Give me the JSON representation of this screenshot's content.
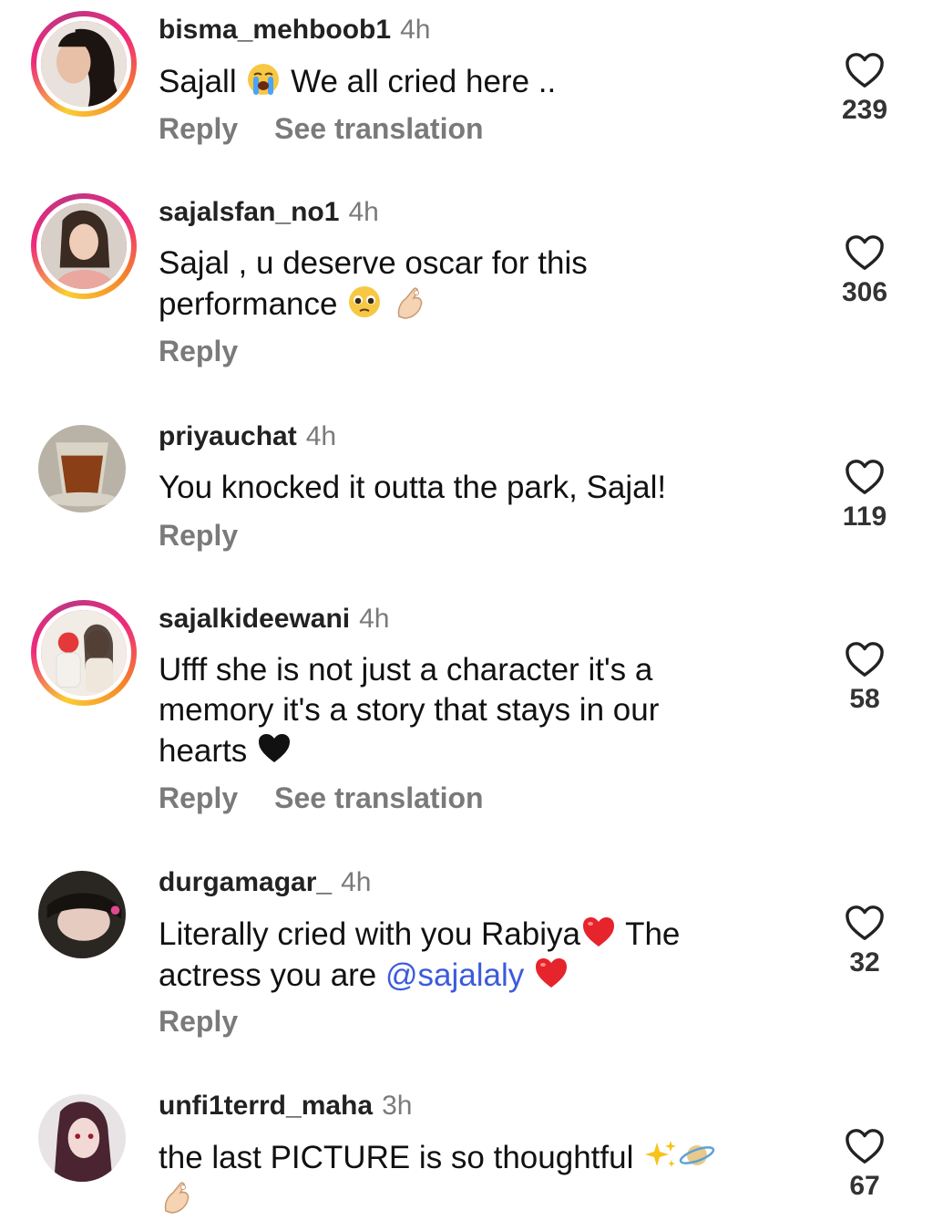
{
  "comments": [
    {
      "username": "bisma_mehboob1",
      "time": "4h",
      "text_parts": [
        "Sajall",
        "We all cried here .."
      ],
      "reply_label": "Reply",
      "translate_label": "See translation",
      "likes": "239"
    },
    {
      "username": "sajalsfan_no1",
      "time": "4h",
      "text_parts": [
        "Sajal , u deserve oscar for this",
        "performance"
      ],
      "reply_label": "Reply",
      "likes": "306"
    },
    {
      "username": "priyauchat",
      "time": "4h",
      "text_parts": [
        "You knocked it outta the park, Sajal!"
      ],
      "reply_label": "Reply",
      "likes": "119"
    },
    {
      "username": "sajalkideewani",
      "time": "4h",
      "text_parts": [
        "Ufff she is not just a character it's a",
        "memory it's a story that stays in our",
        "hearts"
      ],
      "reply_label": "Reply",
      "translate_label": "See translation",
      "likes": "58"
    },
    {
      "username": "durgamagar_",
      "time": "4h",
      "text_parts": [
        "Literally cried with you Rabiya",
        "The",
        "actress you are",
        "@sajalaly"
      ],
      "reply_label": "Reply",
      "likes": "32"
    },
    {
      "username": "unfi1terrd_maha",
      "time": "3h",
      "text_parts": [
        "the last PICTURE is so thoughtful"
      ],
      "likes": "67"
    }
  ],
  "icons": {
    "like": "heart-outline-icon",
    "crying": "crying-face-emoji",
    "pleading": "pleading-face-emoji",
    "pinch": "pinching-hand-emoji",
    "black_heart": "black-heart-emoji",
    "red_heart": "red-heart-emoji",
    "sparkles": "sparkles-emoji",
    "planet": "ringed-planet-emoji"
  },
  "colors": {
    "mention": "#3b5bdb",
    "secondary_text": "#7a7a7a"
  }
}
